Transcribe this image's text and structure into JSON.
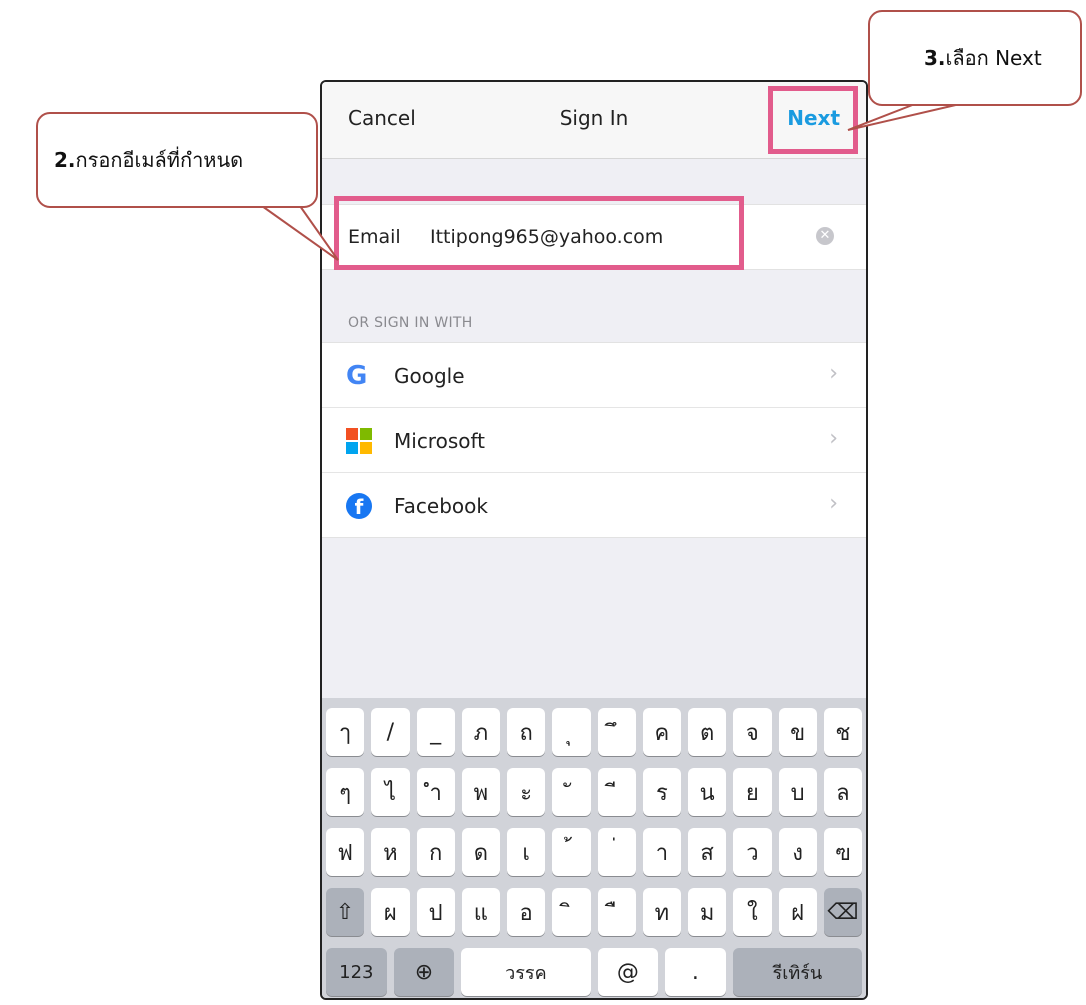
{
  "navbar": {
    "cancel": "Cancel",
    "title": "Sign In",
    "next": "Next"
  },
  "email": {
    "label": "Email",
    "value": "Ittipong965@yahoo.com",
    "clear_icon": "clear-circle-icon"
  },
  "section_header": "OR SIGN IN WITH",
  "providers": [
    {
      "label": "Google",
      "icon": "google-icon"
    },
    {
      "label": "Microsoft",
      "icon": "microsoft-icon"
    },
    {
      "label": "Facebook",
      "icon": "facebook-icon"
    }
  ],
  "keyboard": {
    "row1": [
      "ๅ",
      "/",
      "_",
      "ภ",
      "ถ",
      "ุ",
      "ึ",
      "ค",
      "ต",
      "จ",
      "ข",
      "ช"
    ],
    "row2": [
      "ๆ",
      "ไ",
      "ำ",
      "พ",
      "ะ",
      "ั",
      "ี",
      "ร",
      "น",
      "ย",
      "บ",
      "ล"
    ],
    "row3": [
      "ฟ",
      "ห",
      "ก",
      "ด",
      "เ",
      "้",
      "่",
      "า",
      "ส",
      "ว",
      "ง",
      "ฃ"
    ],
    "row4": [
      "ผ",
      "ป",
      "แ",
      "อ",
      "ิ",
      "ื",
      "ท",
      "ม",
      "ใ",
      "ฝ"
    ],
    "bottom": {
      "numbers": "123",
      "space": "วรรค",
      "at": "@",
      "dot": ".",
      "return": "รีเทิร์น"
    }
  },
  "annotations": {
    "step2_num": "2.",
    "step2_text": "กรอกอีเมล์ที่กำหนด",
    "step3_num": "3.",
    "step3_text": "เลือก Next"
  },
  "colors": {
    "accent": "#1a9be0",
    "highlight": "#e25c8c",
    "callout_border": "#b0504a"
  }
}
